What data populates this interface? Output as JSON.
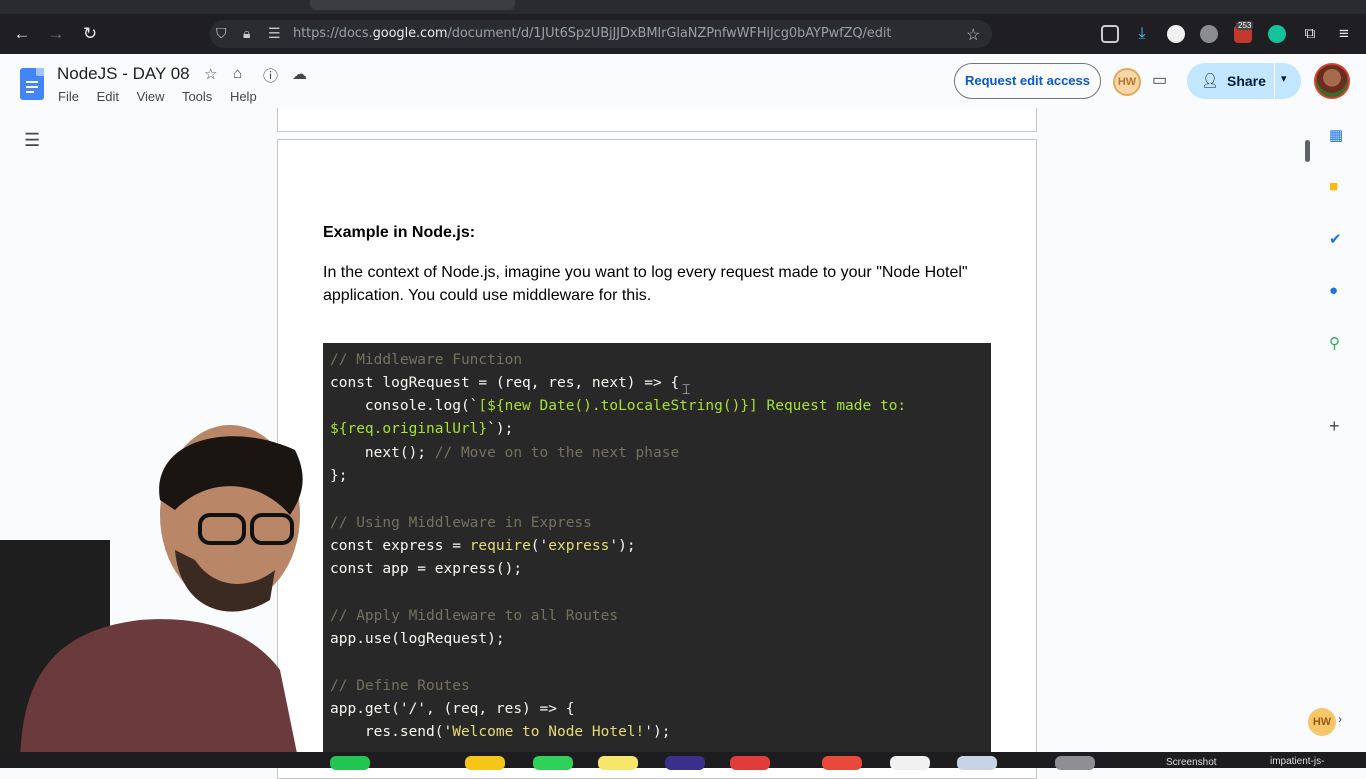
{
  "browser": {
    "url_prefix": "https://docs.",
    "url_domain": "google.com",
    "url_path": "/document/d/1JUt6SpzUBjJJDxBMIrGlaNZPnfwWFHiJcg0bAYPwfZQ/edit",
    "ext_badge_count": "253"
  },
  "docs": {
    "title": "NodeJS - DAY 08",
    "menu": [
      "File",
      "Edit",
      "View",
      "Tools",
      "Help"
    ],
    "request_edit_label": "Request edit access",
    "user_badge": "HW",
    "share_label": "Share"
  },
  "content": {
    "heading": "Example in Node.js:",
    "paragraph": "In the context of Node.js, imagine you want to log every request made to your \"Node Hotel\" application. You could use middleware for this.",
    "code": {
      "l1": "// Middleware Function",
      "l2a": "const logRequest = (req, res, next) => {",
      "l3a": "    console.log(`",
      "l3b": "[${new Date().toLocaleString()}] Request made to:",
      "l4a": "${req.originalUrl}",
      "l4b": "`);",
      "l5a": "    next(); ",
      "l5b": "// Move on to the next phase",
      "l6": "};",
      "l7": "// Using Middleware in Express",
      "l8a": "const express = ",
      "l8b": "require",
      "l8c": "('",
      "l8d": "express",
      "l8e": "');",
      "l9": "const app = express();",
      "l10": "// Apply Middleware to all Routes",
      "l11": "app.use(logRequest);",
      "l12": "// Define Routes",
      "l13": "app.get('/', (req, res) => {",
      "l14a": "    res.send('",
      "l14b": "Welcome to Node Hotel!",
      "l14c": "');"
    }
  },
  "dock": {
    "label_1": "Screenshot",
    "label_2": "impatient-js-"
  },
  "floating_badge": "HW"
}
